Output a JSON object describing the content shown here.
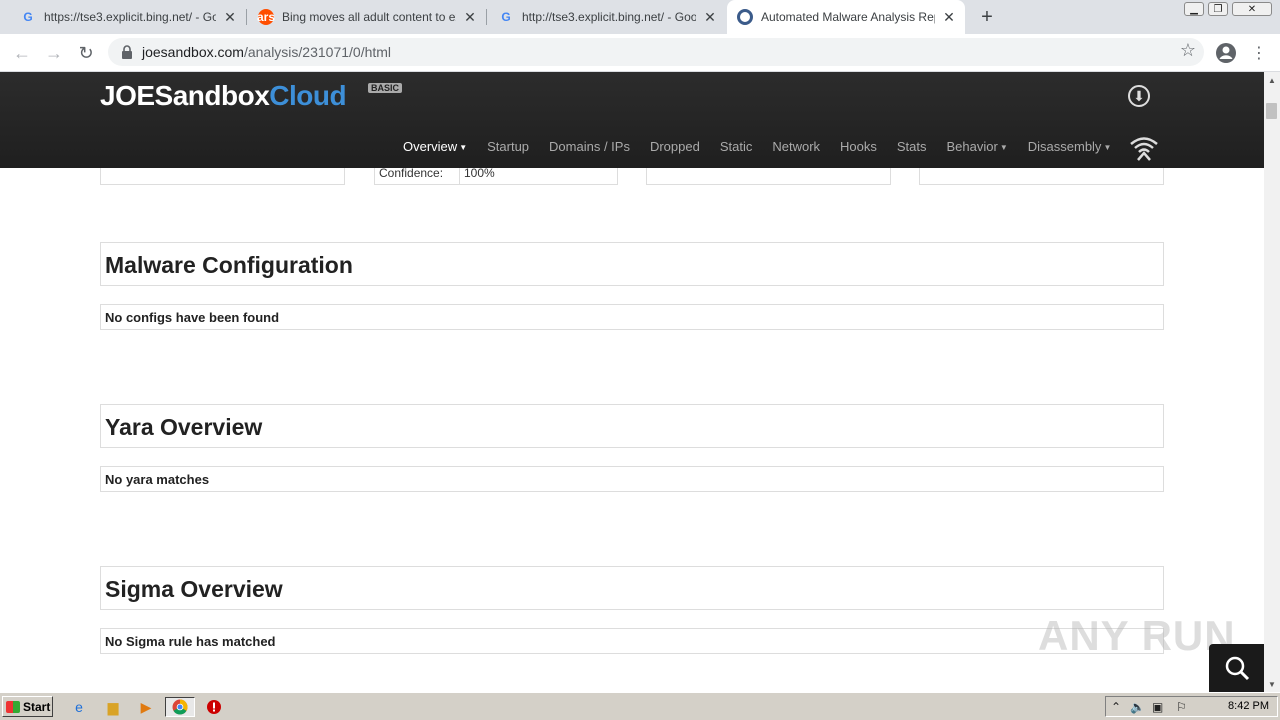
{
  "browser": {
    "tabs": [
      {
        "title": "https://tse3.explicit.bing.net/ - Goog",
        "favicon": "google-icon",
        "active": false
      },
      {
        "title": "Bing moves all adult content to explic",
        "favicon": "ars-icon",
        "active": false
      },
      {
        "title": "http://tse3.explicit.bing.net/ - Googl",
        "favicon": "google-icon",
        "active": false
      },
      {
        "title": "Automated Malware Analysis Report",
        "favicon": "joesandbox-icon",
        "active": true
      }
    ],
    "url_host": "joesandbox.com",
    "url_path": "/analysis/231071/0/html"
  },
  "site": {
    "logo_joe": "JOE",
    "logo_sandbox": "Sandbox",
    "logo_cloud": "Cloud",
    "logo_badge": "BASIC",
    "nav": [
      {
        "label": "Overview",
        "dropdown": true,
        "active": true
      },
      {
        "label": "Startup",
        "dropdown": false,
        "active": false
      },
      {
        "label": "Domains / IPs",
        "dropdown": false,
        "active": false
      },
      {
        "label": "Dropped",
        "dropdown": false,
        "active": false
      },
      {
        "label": "Static",
        "dropdown": false,
        "active": false
      },
      {
        "label": "Network",
        "dropdown": false,
        "active": false
      },
      {
        "label": "Hooks",
        "dropdown": false,
        "active": false
      },
      {
        "label": "Stats",
        "dropdown": false,
        "active": false
      },
      {
        "label": "Behavior",
        "dropdown": true,
        "active": false
      },
      {
        "label": "Disassembly",
        "dropdown": true,
        "active": false
      }
    ]
  },
  "confidence": {
    "label": "Confidence:",
    "value": "100%"
  },
  "sections": {
    "malware": {
      "title": "Malware Configuration",
      "body": "No configs have been found"
    },
    "yara": {
      "title": "Yara Overview",
      "body": "No yara matches"
    },
    "sigma": {
      "title": "Sigma Overview",
      "body": "No Sigma rule has matched"
    }
  },
  "watermark": "ANY RUN",
  "taskbar": {
    "start_label": "Start",
    "clock": "8:42 PM"
  },
  "colors": {
    "header_bg": "#222222",
    "cloud_blue": "#3d8fd8",
    "tabstrip": "#dee1e6",
    "taskbar": "#d4d0c8"
  }
}
